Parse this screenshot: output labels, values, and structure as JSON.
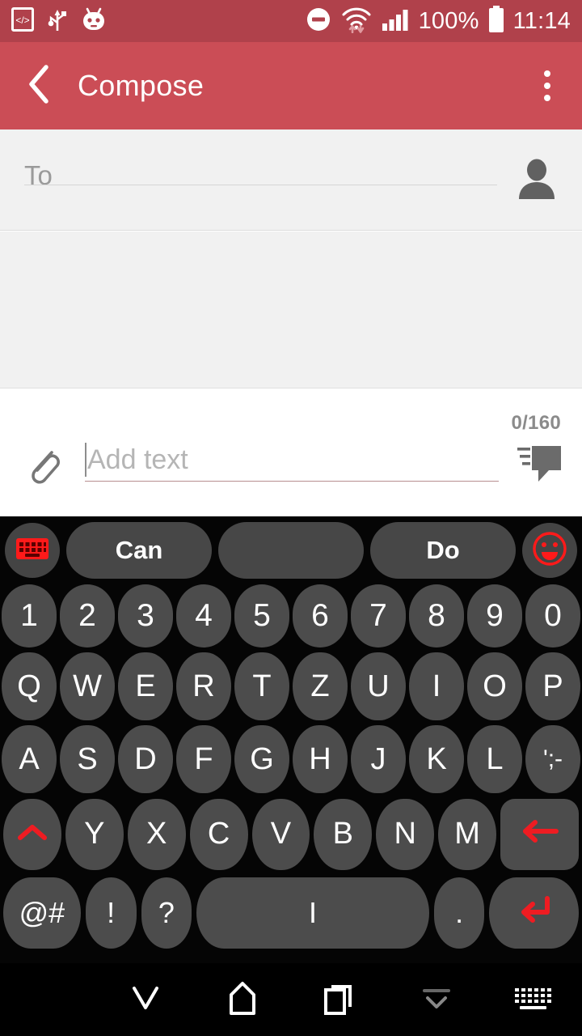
{
  "statusbar": {
    "icons_left": [
      "developer-mode-icon",
      "usb-icon",
      "android-head-icon"
    ],
    "icons_right": [
      "do-not-disturb-icon",
      "wifi-data-icon",
      "signal-bars-icon"
    ],
    "battery_percent": "100%",
    "battery_icon": "battery-full-icon",
    "time": "11:14",
    "bg_color": "#b0414b"
  },
  "appbar": {
    "back_icon": "back-chevron-icon",
    "title": "Compose",
    "overflow_icon": "overflow-menu-icon",
    "bg_color": "#cb4d56"
  },
  "recipient": {
    "placeholder": "To",
    "value": "",
    "contact_icon": "contact-person-icon"
  },
  "message_body": {
    "value": ""
  },
  "compose": {
    "counter": "0/160",
    "attach_icon": "paperclip-icon",
    "text_placeholder": "Add text",
    "text_value": "",
    "send_icon": "send-message-icon"
  },
  "keyboard": {
    "suggestions": {
      "settings_icon": "keyboard-settings-icon",
      "items": [
        "Can",
        "",
        "Do"
      ],
      "emoji_icon": "emoji-smiley-icon",
      "accent_color": "#ff1a1a"
    },
    "row_numbers": [
      "1",
      "2",
      "3",
      "4",
      "5",
      "6",
      "7",
      "8",
      "9",
      "0"
    ],
    "row_top": [
      "Q",
      "W",
      "E",
      "R",
      "T",
      "Z",
      "U",
      "I",
      "O",
      "P"
    ],
    "row_home": [
      "A",
      "S",
      "D",
      "F",
      "G",
      "H",
      "J",
      "K",
      "L",
      "';-"
    ],
    "row_bottom": {
      "shift": "shift-icon",
      "letters": [
        "Y",
        "X",
        "C",
        "V",
        "B",
        "N",
        "M"
      ],
      "backspace": "backspace-icon"
    },
    "row_function": {
      "symbols": "@#",
      "exclaim": "!",
      "question": "?",
      "space": "I",
      "period": ".",
      "enter": "enter-icon"
    }
  },
  "navbar": {
    "buttons": [
      {
        "name": "back-hide-keyboard-icon"
      },
      {
        "name": "home-icon"
      },
      {
        "name": "recents-icon"
      },
      {
        "name": "collapse-chevron-icon"
      },
      {
        "name": "keyboard-switcher-icon"
      }
    ]
  }
}
